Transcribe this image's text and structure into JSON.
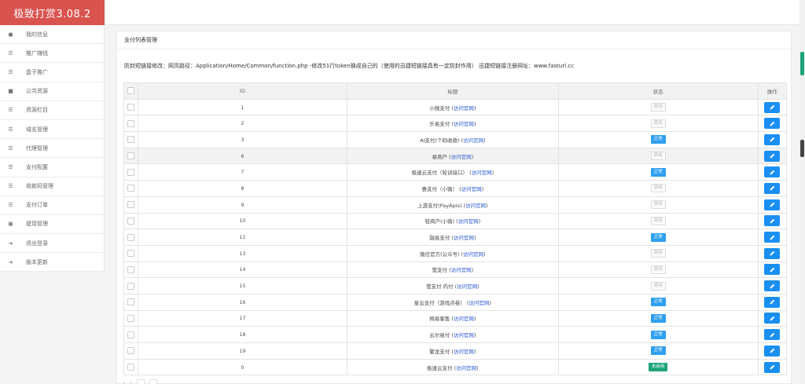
{
  "app": {
    "title": "极致打赏3.08.2"
  },
  "sidebar": {
    "items": [
      {
        "label": "我的信息",
        "icon": "user-icon"
      },
      {
        "label": "推广赚钱",
        "icon": "list-icon"
      },
      {
        "label": "盒子推广",
        "icon": "list-icon"
      },
      {
        "label": "公共资源",
        "icon": "video-icon"
      },
      {
        "label": "资源栏目",
        "icon": "list-icon"
      },
      {
        "label": "域名管理",
        "icon": "list-icon"
      },
      {
        "label": "代理管理",
        "icon": "list-icon"
      },
      {
        "label": "支付配置",
        "icon": "list-icon"
      },
      {
        "label": "收款码管理",
        "icon": "barcode-icon"
      },
      {
        "label": "支付订单",
        "icon": "list-icon"
      },
      {
        "label": "提现管理",
        "icon": "money-icon"
      },
      {
        "label": "退出登录",
        "icon": "signout-icon"
      },
      {
        "label": "版本更新",
        "icon": "signout-icon"
      }
    ]
  },
  "panel": {
    "title": "支付列表管理",
    "notice": "防封短链接修改：网页路径：Application/Home/Common/function.php -修改51行token换成自己的（使用的迅捷短链接具有一定防封作用） 迅捷短链接注册网址：www.fasturl.cc"
  },
  "table": {
    "headers": {
      "id": "ID",
      "title": "标题",
      "state": "状态",
      "op": "操作"
    },
    "link_label": "访问官网",
    "rows": [
      {
        "id": "1",
        "title": "小微支付",
        "status": "禁用",
        "status_type": "off"
      },
      {
        "id": "2",
        "title": "乐易支付",
        "status": "禁用",
        "status_type": "off"
      },
      {
        "id": "3",
        "title": "AI支付(个码收款)",
        "status": "正常",
        "status_type": "on"
      },
      {
        "id": "6",
        "title": "易商户",
        "status": "禁用",
        "status_type": "off"
      },
      {
        "id": "7",
        "title": "极速云支付（轮训接口）",
        "status": "正常",
        "status_type": "on"
      },
      {
        "id": "8",
        "title": "惠支付（小微）",
        "status": "禁用",
        "status_type": "off"
      },
      {
        "id": "9",
        "title": "上游支付(PayApis)",
        "status": "禁用",
        "status_type": "off"
      },
      {
        "id": "10",
        "title": "轻商户(小微)",
        "status": "禁用",
        "status_type": "off"
      },
      {
        "id": "11",
        "title": "融易支付",
        "status": "正常",
        "status_type": "on"
      },
      {
        "id": "13",
        "title": "微信官方(公众号)",
        "status": "禁用",
        "status_type": "off"
      },
      {
        "id": "14",
        "title": "萤支付",
        "status": "禁用",
        "status_type": "off"
      },
      {
        "id": "15",
        "title": "萤支付 内付",
        "status": "禁用",
        "status_type": "off"
      },
      {
        "id": "16",
        "title": "星云支付（游戏点卷）",
        "status": "正常",
        "status_type": "on"
      },
      {
        "id": "17",
        "title": "网易客售",
        "status": "正常",
        "status_type": "on"
      },
      {
        "id": "18",
        "title": "云尔易付",
        "status": "正常",
        "status_type": "on"
      },
      {
        "id": "19",
        "title": "繁龙支付",
        "status": "正常",
        "status_type": "on"
      },
      {
        "id": "0",
        "title": "极速云支付",
        "status": "未启用",
        "status_type": "un"
      }
    ]
  },
  "colors": {
    "brand": "#d9534f",
    "edit": "#1a8ff2",
    "status_on": "#2f9ff0",
    "status_un": "#1fa37b",
    "link": "#2b5bd7"
  }
}
